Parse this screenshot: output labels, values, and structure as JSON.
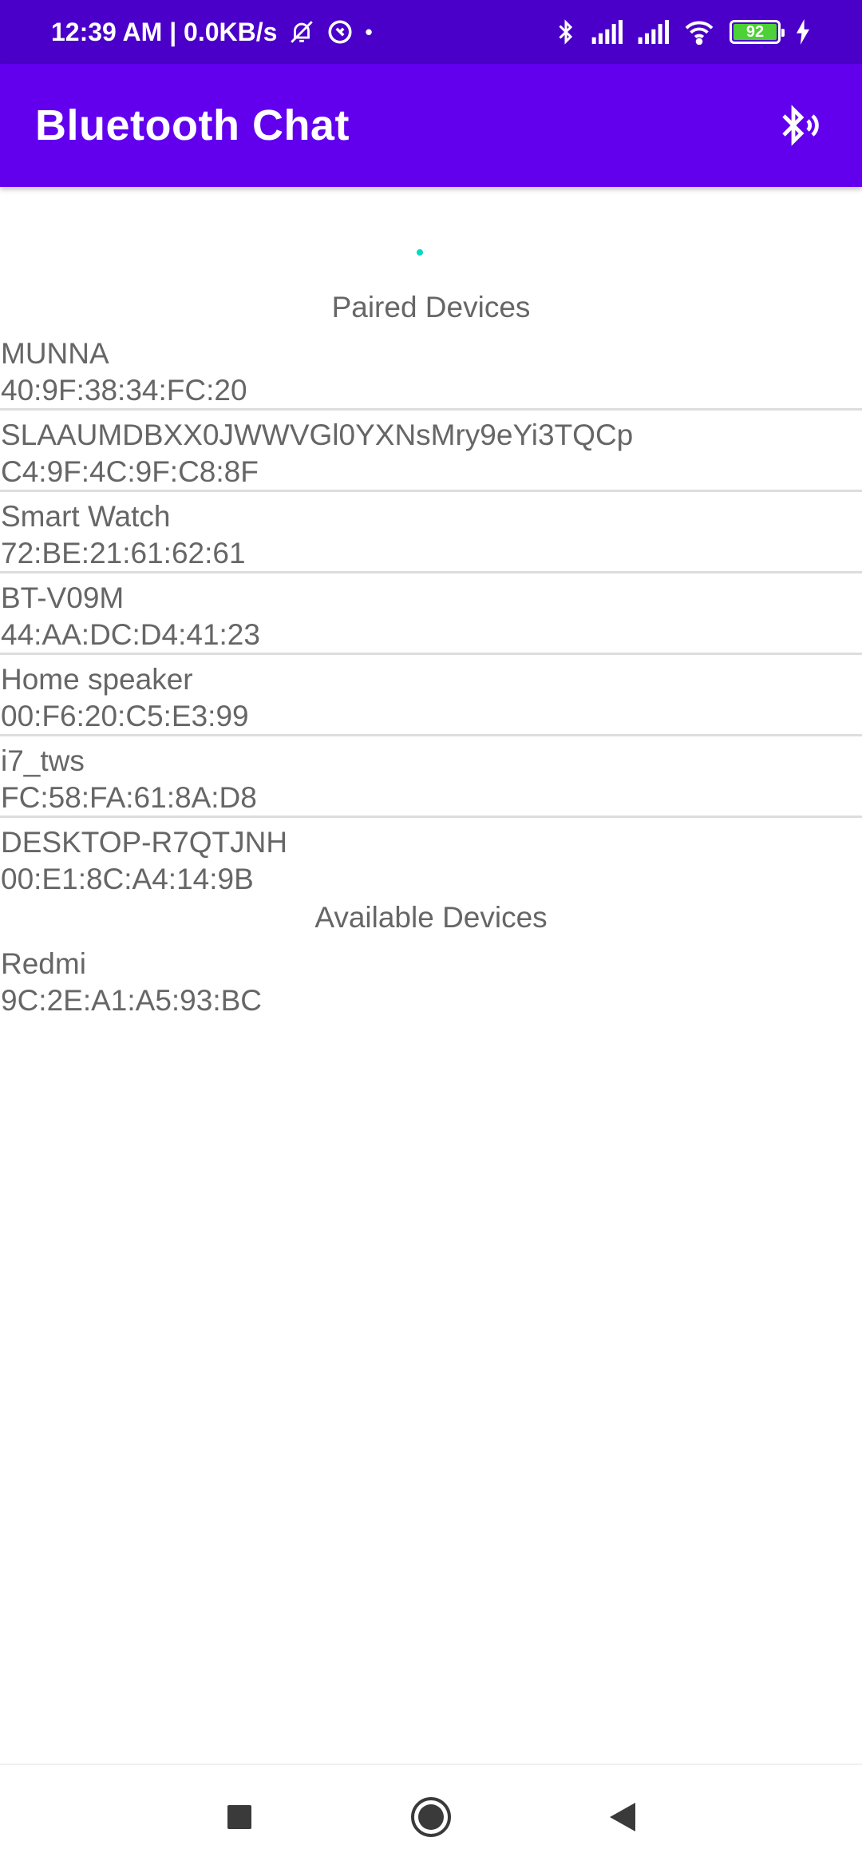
{
  "status_bar": {
    "time_speed": "12:39 AM | 0.0KB/s",
    "dot": "•",
    "battery_level": "92",
    "icons": [
      "mute-icon",
      "data-saver-icon",
      "bluetooth-icon",
      "signal-icon",
      "signal-icon",
      "wifi-icon",
      "battery-icon",
      "charging-icon"
    ]
  },
  "app_bar": {
    "title": "Bluetooth Chat",
    "action_icon": "bluetooth-discoverable-icon"
  },
  "paired": {
    "header": "Paired Devices",
    "devices": [
      {
        "name": "MUNNA",
        "address": "40:9F:38:34:FC:20"
      },
      {
        "name": "SLAAUMDBXX0JWWVGl0YXNsMry9eYi3TQCp",
        "address": "C4:9F:4C:9F:C8:8F"
      },
      {
        "name": "Smart Watch",
        "address": "72:BE:21:61:62:61"
      },
      {
        "name": "BT-V09M",
        "address": "44:AA:DC:D4:41:23"
      },
      {
        "name": "Home speaker",
        "address": "00:F6:20:C5:E3:99"
      },
      {
        "name": "i7_tws",
        "address": "FC:58:FA:61:8A:D8"
      },
      {
        "name": "DESKTOP-R7QTJNH",
        "address": "00:E1:8C:A4:14:9B"
      }
    ]
  },
  "available": {
    "header": "Available Devices",
    "devices": [
      {
        "name": "Redmi",
        "address": "9C:2E:A1:A5:93:BC"
      }
    ]
  },
  "colors": {
    "status_bar": "#4a00c8",
    "app_bar": "#6200ee",
    "text": "#666666",
    "spinner": "#03dac5"
  },
  "nav_bar": {
    "icons": [
      "recents-square-icon",
      "home-circle-icon",
      "back-triangle-icon"
    ]
  }
}
